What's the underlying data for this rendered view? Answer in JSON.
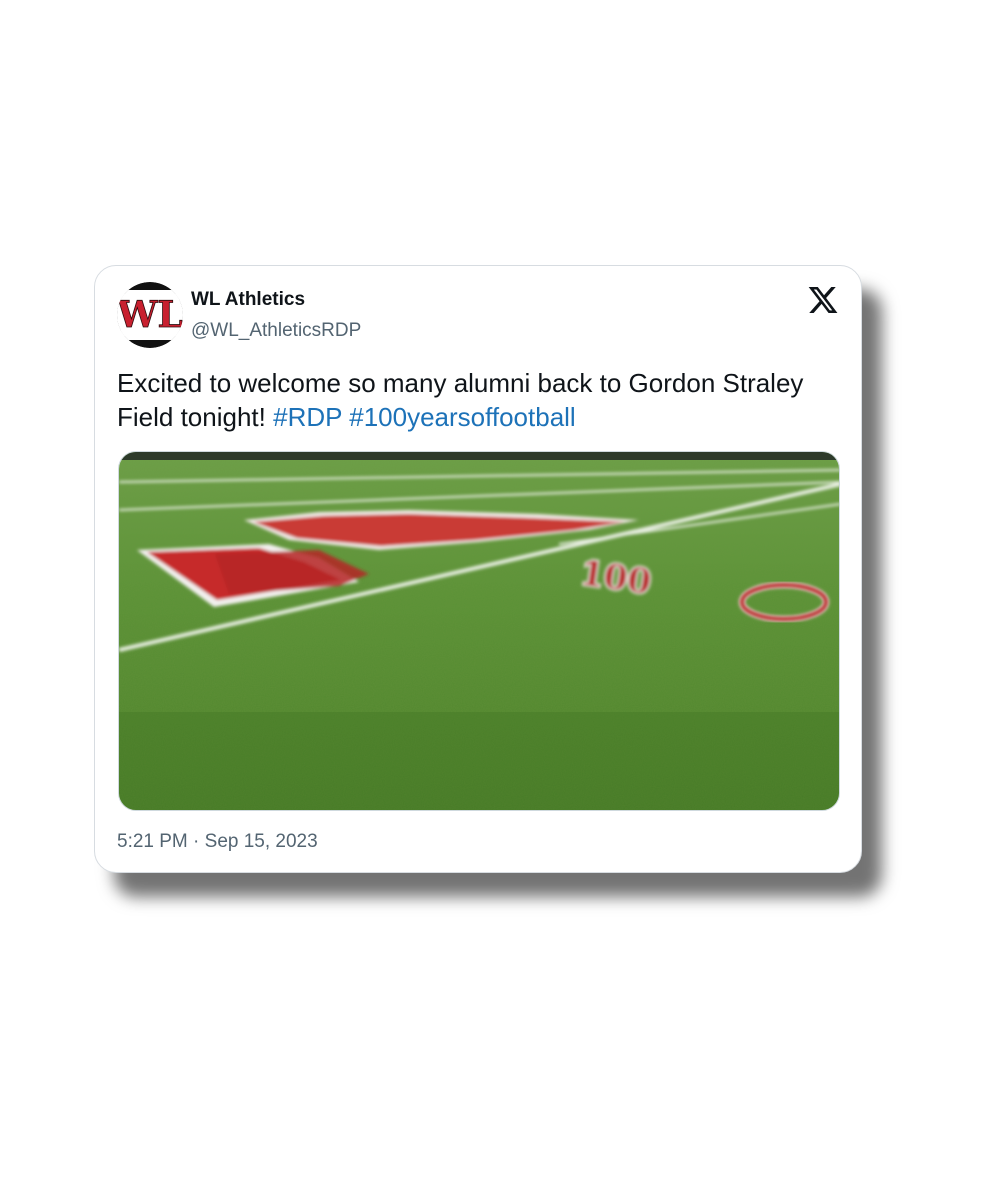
{
  "author": {
    "display_name": "WL Athletics",
    "handle": "@WL_AthleticsRDP",
    "avatar_icon": "wl-logo-icon",
    "avatar_letters": "WL"
  },
  "tweet": {
    "text": "Excited to welcome so many alumni back to Gordon Straley Field tonight!",
    "hashtags": [
      "#RDP",
      "#100yearsoffootball"
    ],
    "timestamp": "5:21 PM · Sep 15, 2023"
  },
  "media": {
    "description_icon": "football-field-photo",
    "field_marking": "100"
  },
  "brand": {
    "logo_icon": "x-logo-icon"
  },
  "colors": {
    "text_primary": "#0f1419",
    "text_secondary": "#536471",
    "link": "#1d72b8",
    "avatar_red": "#c8202f",
    "field_green": "#4f8a2c"
  }
}
